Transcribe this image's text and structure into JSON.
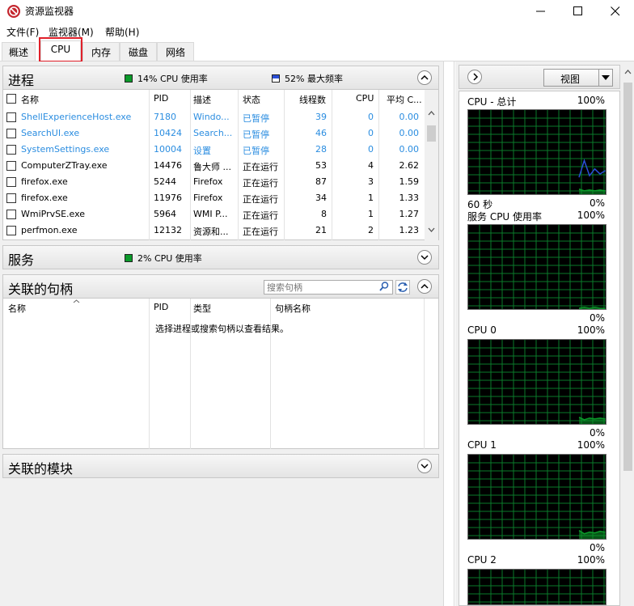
{
  "window": {
    "title": "资源监视器",
    "icon": "resource-monitor-icon"
  },
  "menu": [
    "文件(F)",
    "监视器(M)",
    "帮助(H)"
  ],
  "tabs": [
    {
      "label": "概述",
      "active": false
    },
    {
      "label": "CPU",
      "active": true
    },
    {
      "label": "内存",
      "active": false
    },
    {
      "label": "磁盘",
      "active": false
    },
    {
      "label": "网络",
      "active": false
    }
  ],
  "processes": {
    "title": "进程",
    "cpu_usage": "14% CPU 使用率",
    "max_freq": "52% 最大频率",
    "columns": [
      "名称",
      "PID",
      "描述",
      "状态",
      "线程数",
      "CPU",
      "平均 C..."
    ],
    "rows": [
      {
        "name": "ShellExperienceHost.exe",
        "pid": "7180",
        "desc": "Windo...",
        "status": "已暂停",
        "threads": "39",
        "cpu": "0",
        "avg": "0.00",
        "suspended": true
      },
      {
        "name": "SearchUI.exe",
        "pid": "10424",
        "desc": "Search...",
        "status": "已暂停",
        "threads": "46",
        "cpu": "0",
        "avg": "0.00",
        "suspended": true
      },
      {
        "name": "SystemSettings.exe",
        "pid": "10004",
        "desc": "设置",
        "status": "已暂停",
        "threads": "28",
        "cpu": "0",
        "avg": "0.00",
        "suspended": true
      },
      {
        "name": "ComputerZTray.exe",
        "pid": "14476",
        "desc": "鲁大师 ...",
        "status": "正在运行",
        "threads": "53",
        "cpu": "4",
        "avg": "2.62",
        "suspended": false
      },
      {
        "name": "firefox.exe",
        "pid": "5244",
        "desc": "Firefox",
        "status": "正在运行",
        "threads": "87",
        "cpu": "3",
        "avg": "1.59",
        "suspended": false
      },
      {
        "name": "firefox.exe",
        "pid": "11976",
        "desc": "Firefox",
        "status": "正在运行",
        "threads": "34",
        "cpu": "1",
        "avg": "1.33",
        "suspended": false
      },
      {
        "name": "WmiPrvSE.exe",
        "pid": "5964",
        "desc": "WMI P...",
        "status": "正在运行",
        "threads": "8",
        "cpu": "1",
        "avg": "1.27",
        "suspended": false
      },
      {
        "name": "perfmon.exe",
        "pid": "12132",
        "desc": "资源和...",
        "status": "正在运行",
        "threads": "21",
        "cpu": "2",
        "avg": "1.23",
        "suspended": false
      }
    ]
  },
  "services": {
    "title": "服务",
    "cpu_usage": "2% CPU 使用率"
  },
  "handles": {
    "title": "关联的句柄",
    "search_placeholder": "搜索句柄",
    "columns": [
      "名称",
      "PID",
      "类型",
      "句柄名称"
    ],
    "empty_message": "选择进程或搜索句柄以查看结果。"
  },
  "modules": {
    "title": "关联的模块"
  },
  "graphs_panel": {
    "view_label": "视图",
    "graphs": [
      {
        "title": "CPU - 总计",
        "max": "100%",
        "bottom_left": "60 秒",
        "bottom_right": "0%"
      },
      {
        "title": "服务 CPU 使用率",
        "max": "100%",
        "bottom_left": "",
        "bottom_right": "0%"
      },
      {
        "title": "CPU 0",
        "max": "100%",
        "bottom_left": "",
        "bottom_right": "0%"
      },
      {
        "title": "CPU 1",
        "max": "100%",
        "bottom_left": "",
        "bottom_right": "0%"
      },
      {
        "title": "CPU 2",
        "max": "100%",
        "bottom_left": "",
        "bottom_right": ""
      }
    ]
  },
  "colors": {
    "accent_green": "#0b9a2a",
    "accent_blue": "#2b4fd8",
    "suspended_text": "#2b8de0",
    "tab_highlight": "#e0202a",
    "graph_background": "#000000",
    "graph_grid": "#0a7a2a"
  }
}
